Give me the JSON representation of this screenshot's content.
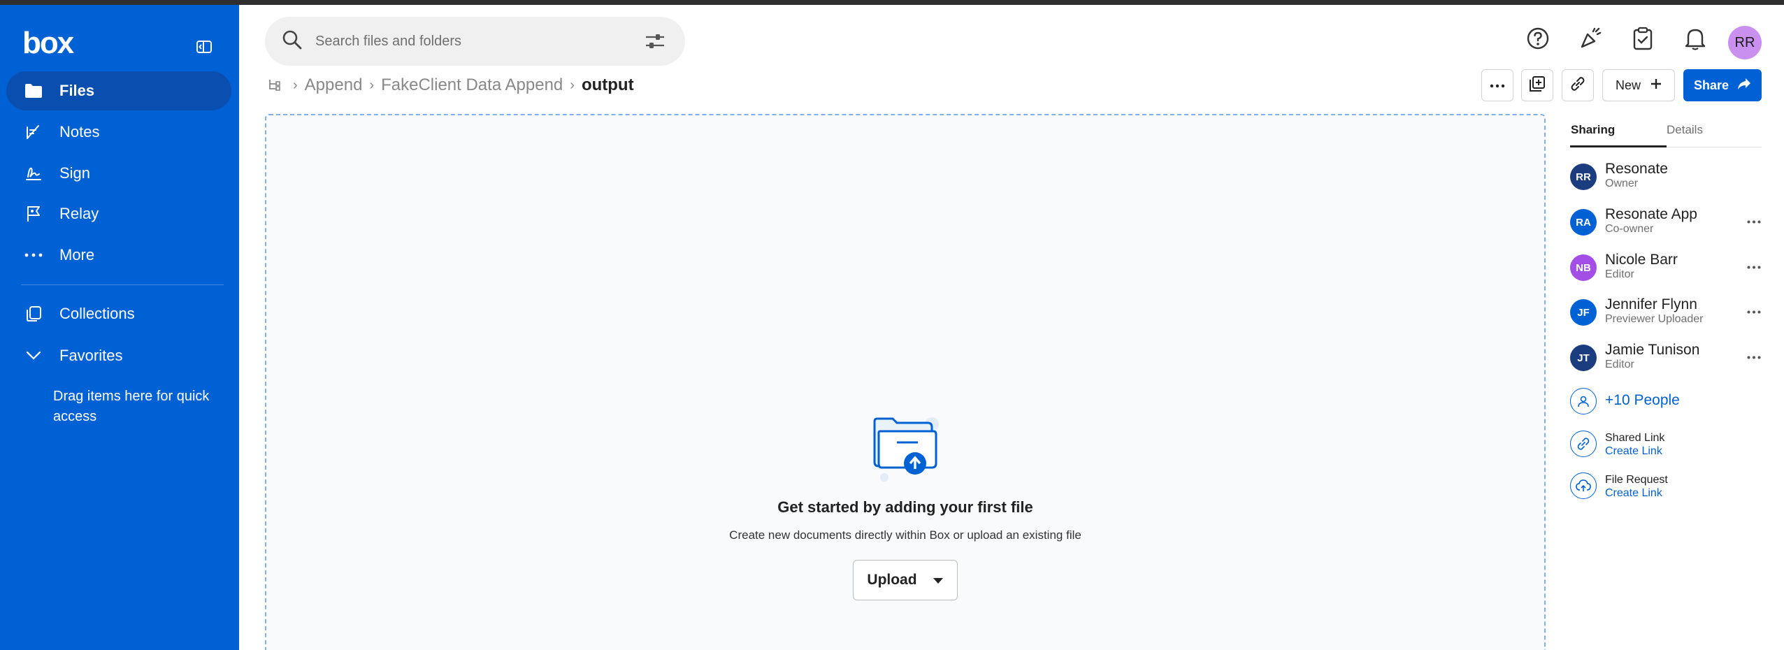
{
  "app": {
    "logo_text": "box",
    "accent": "#0061d5"
  },
  "sidebar": {
    "items": [
      {
        "label": "Files",
        "icon": "folder-icon",
        "active": true
      },
      {
        "label": "Notes",
        "icon": "notes-icon"
      },
      {
        "label": "Sign",
        "icon": "sign-icon"
      },
      {
        "label": "Relay",
        "icon": "relay-icon"
      },
      {
        "label": "More",
        "icon": "more-dots-icon"
      },
      {
        "label": "Collections",
        "icon": "collections-icon"
      },
      {
        "label": "Favorites",
        "icon": "chevron-down-icon"
      }
    ],
    "quick_access": "Drag items here for quick access"
  },
  "search": {
    "placeholder": "Search files and folders"
  },
  "user": {
    "initials": "RR",
    "avatar_color": "#c990f0"
  },
  "breadcrumb": {
    "items": [
      "Append",
      "FakeClient Data Append"
    ],
    "current": "output"
  },
  "toolbar": {
    "new_label": "New",
    "share_label": "Share"
  },
  "empty_state": {
    "title": "Get started by adding your first file",
    "subtitle": "Create new documents directly within Box or upload an existing file",
    "upload_label": "Upload"
  },
  "panel": {
    "tabs": [
      "Sharing",
      "Details"
    ],
    "people": [
      {
        "initials": "RR",
        "name": "Resonate",
        "role": "Owner",
        "color": "#1b3d80"
      },
      {
        "initials": "RA",
        "name": "Resonate App",
        "role": "Co-owner",
        "color": "#0061d5"
      },
      {
        "initials": "NB",
        "name": "Nicole Barr",
        "role": "Editor",
        "color": "#a34ee6"
      },
      {
        "initials": "JF",
        "name": "Jennifer Flynn",
        "role": "Previewer Uploader",
        "color": "#0061d5"
      },
      {
        "initials": "JT",
        "name": "Jamie Tunison",
        "role": "Editor",
        "color": "#1b3d80"
      }
    ],
    "more_people": "+10 People",
    "shared_link": {
      "title": "Shared Link",
      "action": "Create Link"
    },
    "file_request": {
      "title": "File Request",
      "action": "Create Link"
    }
  }
}
